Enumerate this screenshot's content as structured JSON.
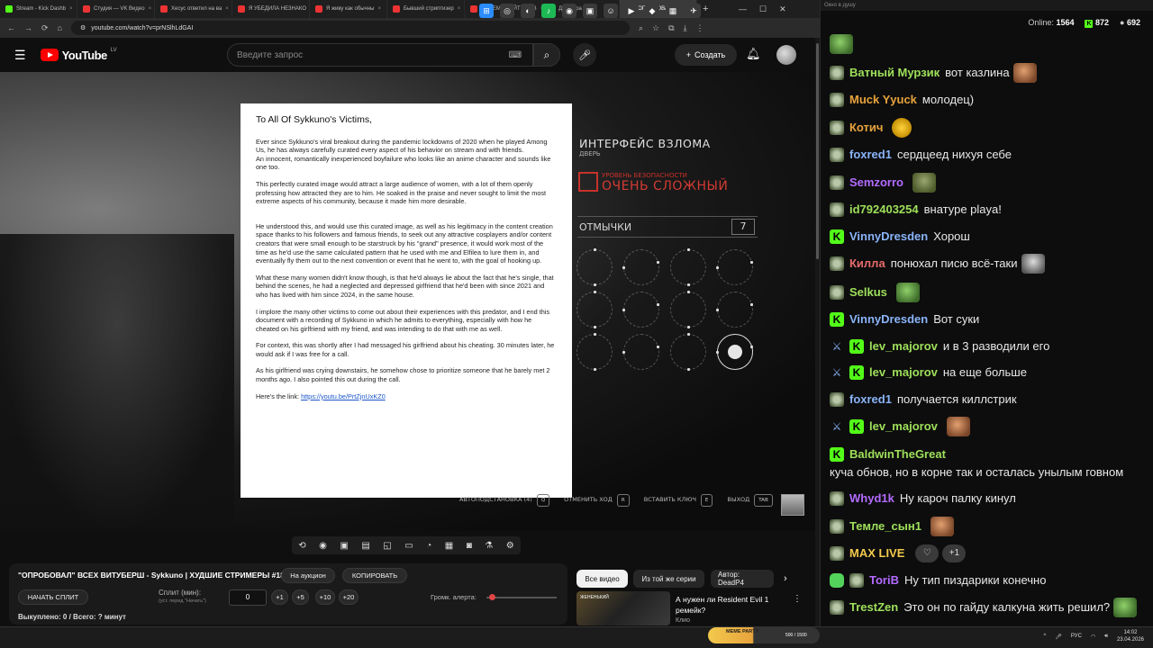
{
  "browser": {
    "tabs": [
      {
        "title": "Stream - Kick Dashb",
        "color": "#53fc18"
      },
      {
        "title": "Студия — VK Видео",
        "color": "#e33"
      },
      {
        "title": "Хесус ответил на ва",
        "color": "#e33"
      },
      {
        "title": "Я УБЕДИЛА НЕЗНАКО",
        "color": "#e33"
      },
      {
        "title": "Я живу как обычны",
        "color": "#e33"
      },
      {
        "title": "Бывший стриптизер",
        "color": "#e33"
      },
      {
        "title": "ПОЧЕМУ НАЙТИ ДЕВ",
        "color": "#e33"
      },
      {
        "title": "ДЖДЖра",
        "color": "#777"
      },
      {
        "title": "\"ОПРОБОВАЛ\"",
        "color": "#e33"
      }
    ],
    "new_tab": "+",
    "url": "youtube.com/watch?v=prNSlhLdGAI"
  },
  "youtube": {
    "logo_text": "YouTube",
    "region": "LV",
    "search_placeholder": "Введите запрос",
    "create_label": "Создать"
  },
  "document": {
    "heading": "To All Of Sykkuno's Victims,",
    "paragraphs": [
      "Ever since Sykkuno's viral breakout during the pandemic lockdowns of 2020 when he played Among Us, he has always carefully curated every aspect of his behavior on stream and with friends.\nAn innocent, romantically inexperienced boyfailure who looks like an anime character and sounds like one too.",
      "This perfectly curated image would attract a large audience of women, with a lot of them openly professing how attracted they are to him. He soaked in the praise and never sought to limit the most extreme aspects of his community, because it made him more desirable.",
      "He understood this, and would use this curated image, as well as his legitimacy in the content creation space thanks to his followers and famous friends, to seek out any attractive cosplayers and/or content creators that were small enough to be starstruck by his \"grand\" presence, it would work most of the time as he'd use the same calculated pattern that he used with me and Elfilea to lure them in, and eventually fly them out to the next convention or event that he went to, with the goal of hooking up.",
      "What these many women didn't know though, is that he'd always lie about the fact that he's single, that behind the scenes, he had a neglected and depressed girlfriend that he'd been with since 2021 and who has lived with him since 2024, in the same house.",
      "I implore the many other victims to come out about their experiences with this predator, and I end this document with a recording of Sykkuno in which he admits to everything, especially with how he cheated on his girlfriend with my friend, and was intending to do that with me as well.",
      "For context, this was shortly after I had messaged his girlfriend about his cheating. 30 minutes later, he would ask if I was free for a call.",
      "As his girlfriend was crying downstairs, he somehow chose to prioritize someone that he barely met 2 months ago. I also pointed this out during the call."
    ],
    "link_prefix": "Here's the link: ",
    "link_text": "https://youtu.be/PrtZjnUxKZ0"
  },
  "game_hud": {
    "title": "ИНТЕРФЕЙС ВЗЛОМА",
    "subtitle": "ДВЕРЬ",
    "security_label": "УРОВЕНЬ БЕЗОПАСНОСТИ",
    "security_value": "ОЧЕНЬ СЛОЖНЫЙ",
    "picks_label": "ОТМЫЧКИ",
    "picks_count": "7",
    "hints": [
      {
        "label": "АВТОПОДСТАНОВКА (4)",
        "key": "Q"
      },
      {
        "label": "ОТМЕНИТЬ ХОД",
        "key": "R"
      },
      {
        "label": "ВСТАВИТЬ КЛЮЧ",
        "key": "E"
      },
      {
        "label": "ВЫХОД",
        "key": "TAB"
      }
    ]
  },
  "video_meta": {
    "title": "\"ОПРОБОВАЛ\" ВСЕХ ВИТУБЕРШ - Sykkuno | ХУДШИЕ СТРИМЕРЫ #18",
    "auction_button": "На аукцион",
    "copy_button": "КОПИРОВАТЬ",
    "start_split_button": "НАЧАТЬ СПЛИТ",
    "split_label": "Сплит (мин):",
    "split_hint": "(уст. перед \"Начать\")",
    "split_value": "0",
    "increments": [
      "+1",
      "+5",
      "+10",
      "+20"
    ],
    "alert_volume_label": "Громк. алерта:",
    "alert_volume": 0.08,
    "progress_text": "Выкуплено: 0 / Всего: ? минут"
  },
  "recommendations": {
    "chips": [
      "Все видео",
      "Из той же серии",
      "Автор: DeadP4"
    ],
    "item": {
      "title": "А нужен ли Resident Evil 1 ремейк?",
      "channel": "Клио",
      "thumb_text": "ЖЕНЕНЬКИЙ"
    }
  },
  "chat": {
    "window_title": "Окно в душу",
    "online_label": "Online:",
    "online_count": "1564",
    "kick_count": "872",
    "other_count": "692",
    "messages": [
      {
        "user": "Ватный Мурзик",
        "color": "#9ee05a",
        "badge": "avatar",
        "text": "вот казлина",
        "emote": "face"
      },
      {
        "user": "Muck Yyuck",
        "color": "#e8a33c",
        "badge": "avatar",
        "text": "молодец)",
        "emote": ""
      },
      {
        "user": "Котич",
        "color": "#e8a33c",
        "badge": "avatar",
        "text": "",
        "emote": "yellow"
      },
      {
        "user": "foxred1",
        "color": "#8ab4f8",
        "badge": "avatar",
        "text": "сердцеед нихуя себе",
        "emote": ""
      },
      {
        "user": "Semzorro",
        "color": "#b36bff",
        "badge": "avatar",
        "text": "",
        "emote": "lizard"
      },
      {
        "user": "id792403254",
        "color": "#9ee05a",
        "badge": "avatar",
        "text": "внатуре playa!",
        "emote": ""
      },
      {
        "user": "VinnyDresden",
        "color": "#8ab4f8",
        "badge": "k",
        "text": "Хорош",
        "emote": ""
      },
      {
        "user": "Килла",
        "color": "#e86b6b",
        "badge": "avatar",
        "text": "понюхал писю всё-таки",
        "emote": "grey"
      },
      {
        "user": "Selkus",
        "color": "#9ee05a",
        "badge": "avatar",
        "text": "",
        "emote": "green"
      },
      {
        "user": "VinnyDresden",
        "color": "#8ab4f8",
        "badge": "k",
        "text": "Вот суки",
        "emote": ""
      },
      {
        "user": "lev_majorov",
        "color": "#9ee05a",
        "badge": "swordk",
        "text": "и в 3 разводили его",
        "emote": ""
      },
      {
        "user": "lev_majorov",
        "color": "#9ee05a",
        "badge": "swordk",
        "text": "на еще больше",
        "emote": ""
      },
      {
        "user": "foxred1",
        "color": "#8ab4f8",
        "badge": "avatar",
        "text": "получается киллстрик",
        "emote": ""
      },
      {
        "user": "lev_majorov",
        "color": "#9ee05a",
        "badge": "swordk",
        "text": "",
        "emote": "face"
      },
      {
        "user": "BaldwinTheGreat",
        "color": "#9ee05a",
        "badge": "k",
        "text": "куча обнов, но в корне так и осталась унылым говном",
        "emote": ""
      },
      {
        "user": "Whyd1k",
        "color": "#b36bff",
        "badge": "avatar",
        "text": "Ну кароч палку кинул",
        "emote": ""
      },
      {
        "user": "Темле_сын1",
        "color": "#9ee05a",
        "badge": "avatar",
        "text": "",
        "emote": "face"
      },
      {
        "user": "MAX LIVE",
        "color": "#f2c94c",
        "badge": "avatar",
        "text": "",
        "emote": "react"
      },
      {
        "user": "ToriB",
        "color": "#b36bff",
        "badge": "shield",
        "text": "Ну тип пиздарики конечно",
        "emote": ""
      },
      {
        "user": "TrestZen",
        "color": "#9ee05a",
        "badge": "avatar",
        "text": "Это он по гайду калкуна жить решил?",
        "emote": "green"
      }
    ],
    "react_plus": "+1"
  },
  "taskbar": {
    "meme_party_label": "MEME PARTY",
    "meme_party_count": "500 / 1500",
    "lang": "РУС",
    "time": "14:02",
    "date": "23.04.2026"
  }
}
